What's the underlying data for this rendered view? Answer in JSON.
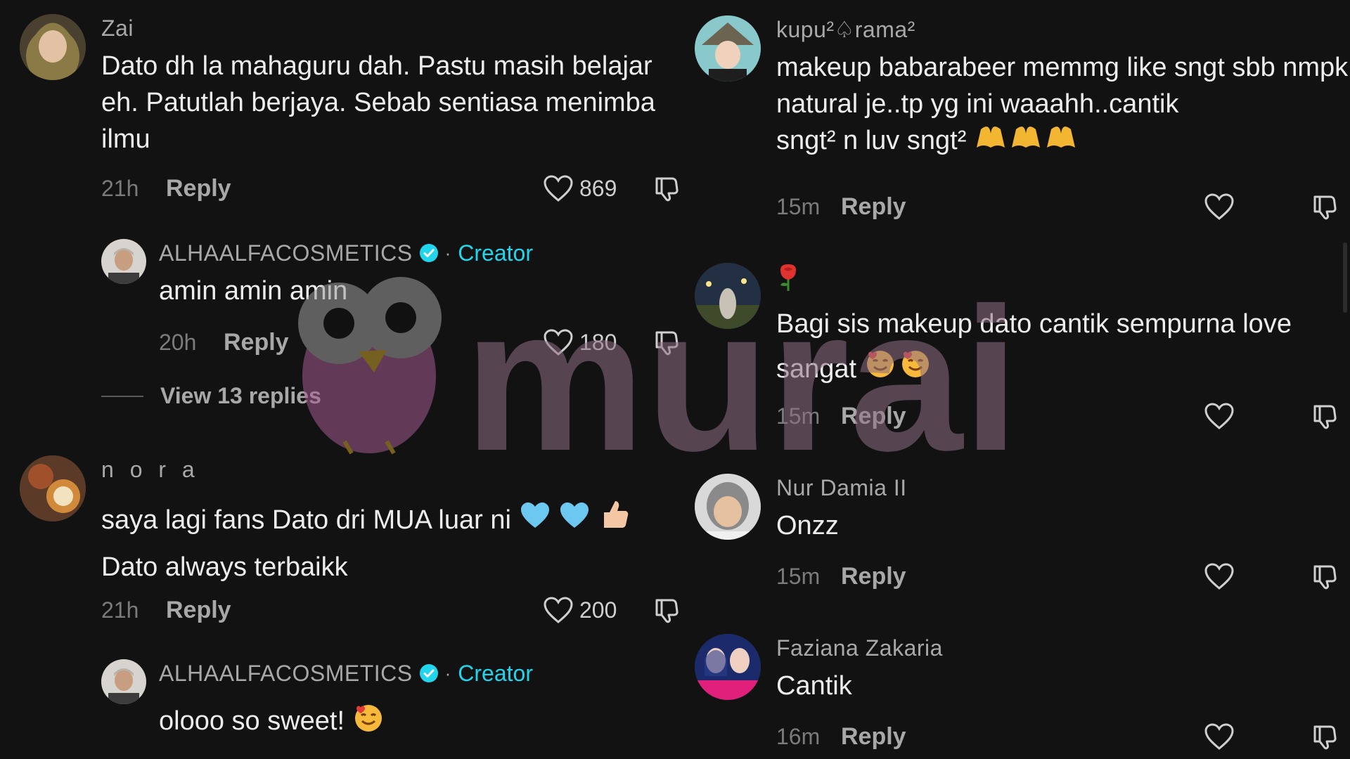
{
  "watermark_text": "murai",
  "left_column": {
    "c1": {
      "username": "Zai",
      "text": "Dato dh la mahaguru dah. Pastu masih belajar eh. Patutlah berjaya. Sebab sentiasa menimba ilmu",
      "time": "21h",
      "reply_label": "Reply",
      "likes": "869"
    },
    "r1": {
      "username": "ALHAALFACOSMETICS",
      "badge": "Creator",
      "separator": "·",
      "text": "amin amin amin",
      "time": "20h",
      "reply_label": "Reply",
      "likes": "180"
    },
    "view_replies": "View 13 replies",
    "c2": {
      "username": "n o r a",
      "text": "saya lagi fans Dato dri MUA luar ni",
      "text2": "Dato always terbaikk",
      "time": "21h",
      "reply_label": "Reply",
      "likes": "200"
    },
    "r2": {
      "username": "ALHAALFACOSMETICS",
      "badge": "Creator",
      "separator": "·",
      "text": "olooo so sweet!"
    }
  },
  "right_column": {
    "c3": {
      "username": "kupu²♤rama²",
      "text": "makeup babarabeer memmg like sngt sbb nmpk natural je..tp yg ini waaahh..cantik",
      "text2": "sngt² n luv sngt²",
      "time": "15m",
      "reply_label": "Reply"
    },
    "c4": {
      "username_emoji": "rose",
      "text": "Bagi sis makeup dato cantik sempurna love",
      "text2": "sangat",
      "time": "15m",
      "reply_label": "Reply"
    },
    "c5": {
      "username": "Nur Damia II",
      "text": "Onzz",
      "time": "15m",
      "reply_label": "Reply"
    },
    "c6": {
      "username": "Faziana Zakaria",
      "text": "Cantik",
      "time": "16m",
      "reply_label": "Reply"
    }
  },
  "colors": {
    "background": "#121212",
    "accent": "#20d5ec",
    "muted": "#a8a8a8"
  }
}
